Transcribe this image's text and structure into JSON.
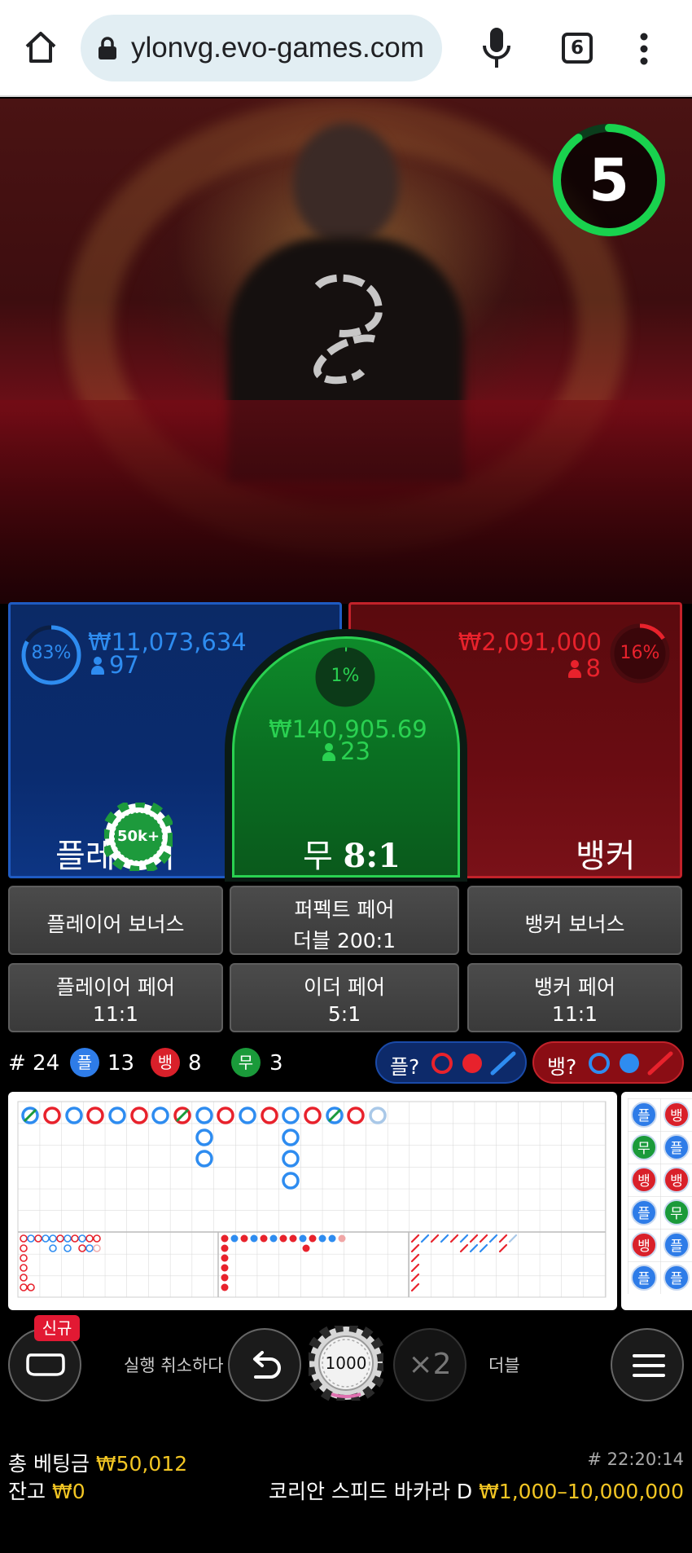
{
  "browser": {
    "url": "ylonvg.evo-games.com",
    "tab_count": "6",
    "icons": [
      "home-icon",
      "lock-icon",
      "mic-icon",
      "more-vert-icon"
    ]
  },
  "game": {
    "timer": "5",
    "timer_progress": 0.9
  },
  "player": {
    "percent": "83%",
    "percent_value": 0.83,
    "amount": "₩11,073,634",
    "count": "97",
    "label": "플레이어",
    "chip": "50k+",
    "color": "#2e8cf0"
  },
  "tie": {
    "percent": "1%",
    "percent_value": 0.01,
    "amount": "₩140,905.69",
    "count": "23",
    "label": "무",
    "payout": "8:1",
    "color": "#2ad151"
  },
  "banker": {
    "percent": "16%",
    "percent_value": 0.16,
    "amount": "₩2,091,000",
    "count": "8",
    "label": "뱅커",
    "color": "#e8222c"
  },
  "side_bets": {
    "player_bonus": "플레이어 보너스",
    "perfect_pair": "퍼펙트 페어",
    "perfect_pair_payout": "더블 200:1",
    "banker_bonus": "뱅커 보너스",
    "player_pair": "플레이어 페어",
    "player_pair_payout": "11:1",
    "either_pair": "이더 페어",
    "either_pair_payout": "5:1",
    "banker_pair": "뱅커 페어",
    "banker_pair_payout": "11:1"
  },
  "stats": {
    "rounds": "# 24",
    "player_badge": "플",
    "player_wins": "13",
    "banker_badge": "뱅",
    "banker_wins": "8",
    "tie_badge": "무",
    "tie_wins": "3",
    "player_ask": "플?",
    "banker_ask": "뱅?"
  },
  "bead_plate": [
    [
      "플",
      "뱅"
    ],
    [
      "무",
      "플"
    ],
    [
      "뱅",
      "뱅"
    ],
    [
      "플",
      "무"
    ],
    [
      "뱅",
      "플"
    ],
    [
      "플",
      "플"
    ]
  ],
  "controls": {
    "new_badge": "신규",
    "undo": "실행 취소하다",
    "chip": "1000",
    "double_icon": "×2",
    "double": "더블"
  },
  "footer": {
    "total_bet_label": "총 베팅금",
    "total_bet": "₩50,012",
    "balance_label": "잔고",
    "balance": "₩0",
    "time": "# 22:20:14",
    "table_name": "코리안 스피드 바카라 D",
    "limits": "₩1,000–10,000,000"
  }
}
